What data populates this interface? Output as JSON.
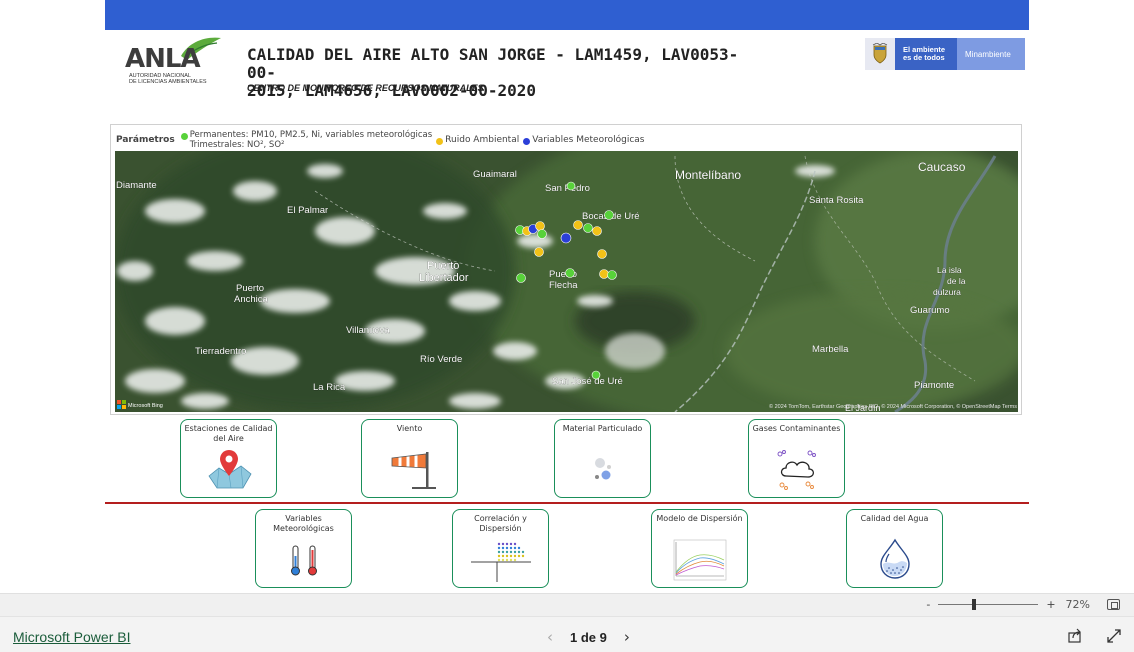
{
  "header": {
    "title_line1": "CALIDAD DEL AIRE ALTO SAN JORGE - LAM1459, LAV0053-00-",
    "title_line2": "2015, LAM4656, LAV0002-00-2020",
    "subtitle": "CENTRO DE MONITOREO DE RECURSOS NATURALES"
  },
  "logo": {
    "text": "ANLA",
    "sub1": "AUTORIDAD NACIONAL",
    "sub2": "DE LICENCIAS AMBIENTALES"
  },
  "gov_banner": {
    "amb_line1": "El ambiente",
    "amb_line2": "es de todos",
    "ministry": "Minambiente"
  },
  "legend": {
    "label": "Parámetros",
    "items": [
      {
        "line1": "Permanentes: PM10, PM2.5, Ni, variables meteorológicas",
        "line2": "Trimestrales: NO², SO²",
        "color": "#58d23a"
      },
      {
        "line1": "Ruido Ambiental",
        "color": "#f2c218"
      },
      {
        "line1": "Variables Meteorológicas",
        "color": "#2b3fd8"
      }
    ]
  },
  "map": {
    "places": [
      {
        "name": "Diamante"
      },
      {
        "name": "Guaimaral"
      },
      {
        "name": "San Pedro"
      },
      {
        "name": "Montelíbano"
      },
      {
        "name": "Caucaso"
      },
      {
        "name": "El Palmar"
      },
      {
        "name": "Bocas de Uré"
      },
      {
        "name": "Santa Rosita"
      },
      {
        "name": "Puerto"
      },
      {
        "name": "Libertador"
      },
      {
        "name": "Puerto"
      },
      {
        "name": "Flecha"
      },
      {
        "name": "La isla"
      },
      {
        "name": "de la"
      },
      {
        "name": "dulzura"
      },
      {
        "name": "Puerto"
      },
      {
        "name": "Anchica"
      },
      {
        "name": "Guarumo"
      },
      {
        "name": "Villanueva"
      },
      {
        "name": "Tierradentro"
      },
      {
        "name": "Río Verde"
      },
      {
        "name": "Marbella"
      },
      {
        "name": "La Rica"
      },
      {
        "name": "San José de Uré"
      },
      {
        "name": "Piamonte"
      },
      {
        "name": "El Jardín"
      }
    ],
    "attribution": "© 2024 TomTom, Earthstar Geographics SIO, © 2024 Microsoft Corporation, © OpenStreetMap  Terms",
    "bing": "Microsoft Bing"
  },
  "buttons_row1": [
    {
      "label": "Estaciones de Calidad del Aire",
      "icon": "map-pin-icon"
    },
    {
      "label": "Viento",
      "icon": "windsock-icon"
    },
    {
      "label": "Material Particulado",
      "icon": "particles-icon"
    },
    {
      "label": "Gases Contaminantes",
      "icon": "cloud-molecules-icon"
    }
  ],
  "buttons_row2": [
    {
      "label": "Variables Meteorológicas",
      "icon": "thermometer-icon"
    },
    {
      "label": "Correlación y Dispersión",
      "icon": "scatter-icon"
    },
    {
      "label": "Modelo de Dispersión",
      "icon": "dispersion-chart-icon"
    },
    {
      "label": "Calidad del Agua",
      "icon": "water-drop-icon"
    }
  ],
  "zoom": {
    "minus": "-",
    "plus": "+",
    "percent": "72%"
  },
  "footer": {
    "brand": "Microsoft Power BI",
    "page_indicator": "1 de 9",
    "prev": "‹",
    "next": "›"
  }
}
